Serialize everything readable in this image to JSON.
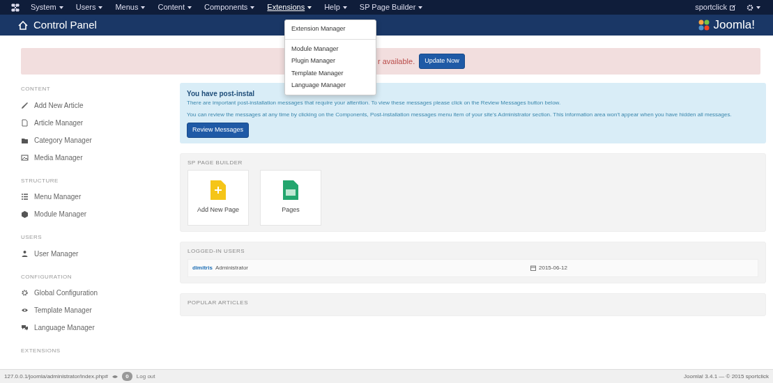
{
  "topbar": {
    "menus": [
      {
        "label": "System",
        "selected": false
      },
      {
        "label": "Users",
        "selected": false
      },
      {
        "label": "Menus",
        "selected": false
      },
      {
        "label": "Content",
        "selected": false
      },
      {
        "label": "Components",
        "selected": false
      },
      {
        "label": "Extensions",
        "selected": true
      },
      {
        "label": "Help",
        "selected": false
      },
      {
        "label": "SP Page Builder",
        "selected": false
      }
    ],
    "site_link": "sportclick",
    "dropdown": {
      "items": [
        {
          "label": "Extension Manager",
          "kind": "item"
        },
        {
          "kind": "divider"
        },
        {
          "label": "Module Manager",
          "kind": "item"
        },
        {
          "label": "Plugin Manager",
          "kind": "item"
        },
        {
          "label": "Template Manager",
          "kind": "item"
        },
        {
          "label": "Language Manager",
          "kind": "item"
        }
      ]
    }
  },
  "header": {
    "title": "Control Panel",
    "logo_text": "Joomla!"
  },
  "update_alert": {
    "text": "r available.",
    "button": "Update Now"
  },
  "sidebar": {
    "sections": [
      {
        "heading": "CONTENT",
        "items": [
          "Add New Article",
          "Article Manager",
          "Category Manager",
          "Media Manager"
        ]
      },
      {
        "heading": "STRUCTURE",
        "items": [
          "Menu Manager",
          "Module Manager"
        ]
      },
      {
        "heading": "USERS",
        "items": [
          "User Manager"
        ]
      },
      {
        "heading": "CONFIGURATION",
        "items": [
          "Global Configuration",
          "Template Manager",
          "Language Manager"
        ]
      },
      {
        "heading": "EXTENSIONS"
      }
    ]
  },
  "postinstall": {
    "title": "You have post-instal",
    "paragraphs": [
      "There are important post-installation messages that require your attention. To view these messages please click on the Review Messages button below.",
      "You can review the messages at any time by clicking on the Components, Post-installation messages menu item of your site's Administrator section. This information area won't appear when you have hidden all messages."
    ],
    "button": "Review Messages"
  },
  "page_builder": {
    "heading": "SP PAGE BUILDER",
    "tiles": [
      {
        "label": "Add New Page",
        "kind": "add"
      },
      {
        "label": "Pages",
        "kind": "pages"
      }
    ]
  },
  "logged_in": {
    "heading": "LOGGED-IN USERS",
    "rows": [
      {
        "user": "dimitris",
        "role": "Administrator",
        "date": "2015-06-12"
      }
    ]
  },
  "popular": {
    "heading": "POPULAR ARTICLES"
  },
  "status_bar": {
    "url": "127.0.0.1/joomla/administrator/index.php#",
    "count": "0",
    "logout": "Log out",
    "version": "Joomla! 3.4.1 — © 2015 sportclick"
  }
}
